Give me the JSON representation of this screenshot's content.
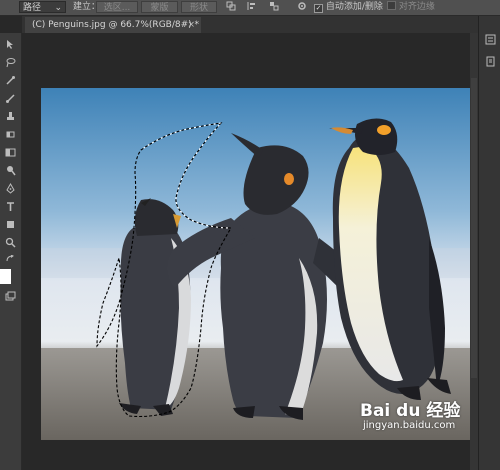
{
  "options_bar": {
    "mode_select": "路径",
    "make_label": "建立：",
    "selection_button": "选区...",
    "mask_button": "蒙版",
    "shape_button": "形状",
    "auto_add_delete_label": "自动添加/删除",
    "auto_add_delete_checked": true,
    "align_edges_label": "对齐边缘",
    "align_edges_checked": false,
    "checkmark_glyph": "✓"
  },
  "document_tab": {
    "title": "(C) Penguins.jpg @ 66.7%(RGB/8#) *",
    "close_glyph": "×"
  },
  "watermark": {
    "brand": "Bai du 经验",
    "url": "jingyan.baidu.com"
  },
  "colors": {
    "accent_ui": "#505050",
    "canvas_bg": "#282828",
    "path_stroke": "#000000"
  },
  "icons": {
    "toolbar": [
      "move-icon",
      "lasso-icon",
      "eyedropper-icon",
      "brush-icon",
      "stamp-icon",
      "eraser-icon",
      "gradient-icon",
      "dodge-icon",
      "pen-icon",
      "type-icon",
      "shape-icon",
      "zoom-icon"
    ],
    "right_panel": [
      "history-icon",
      "properties-icon"
    ]
  }
}
